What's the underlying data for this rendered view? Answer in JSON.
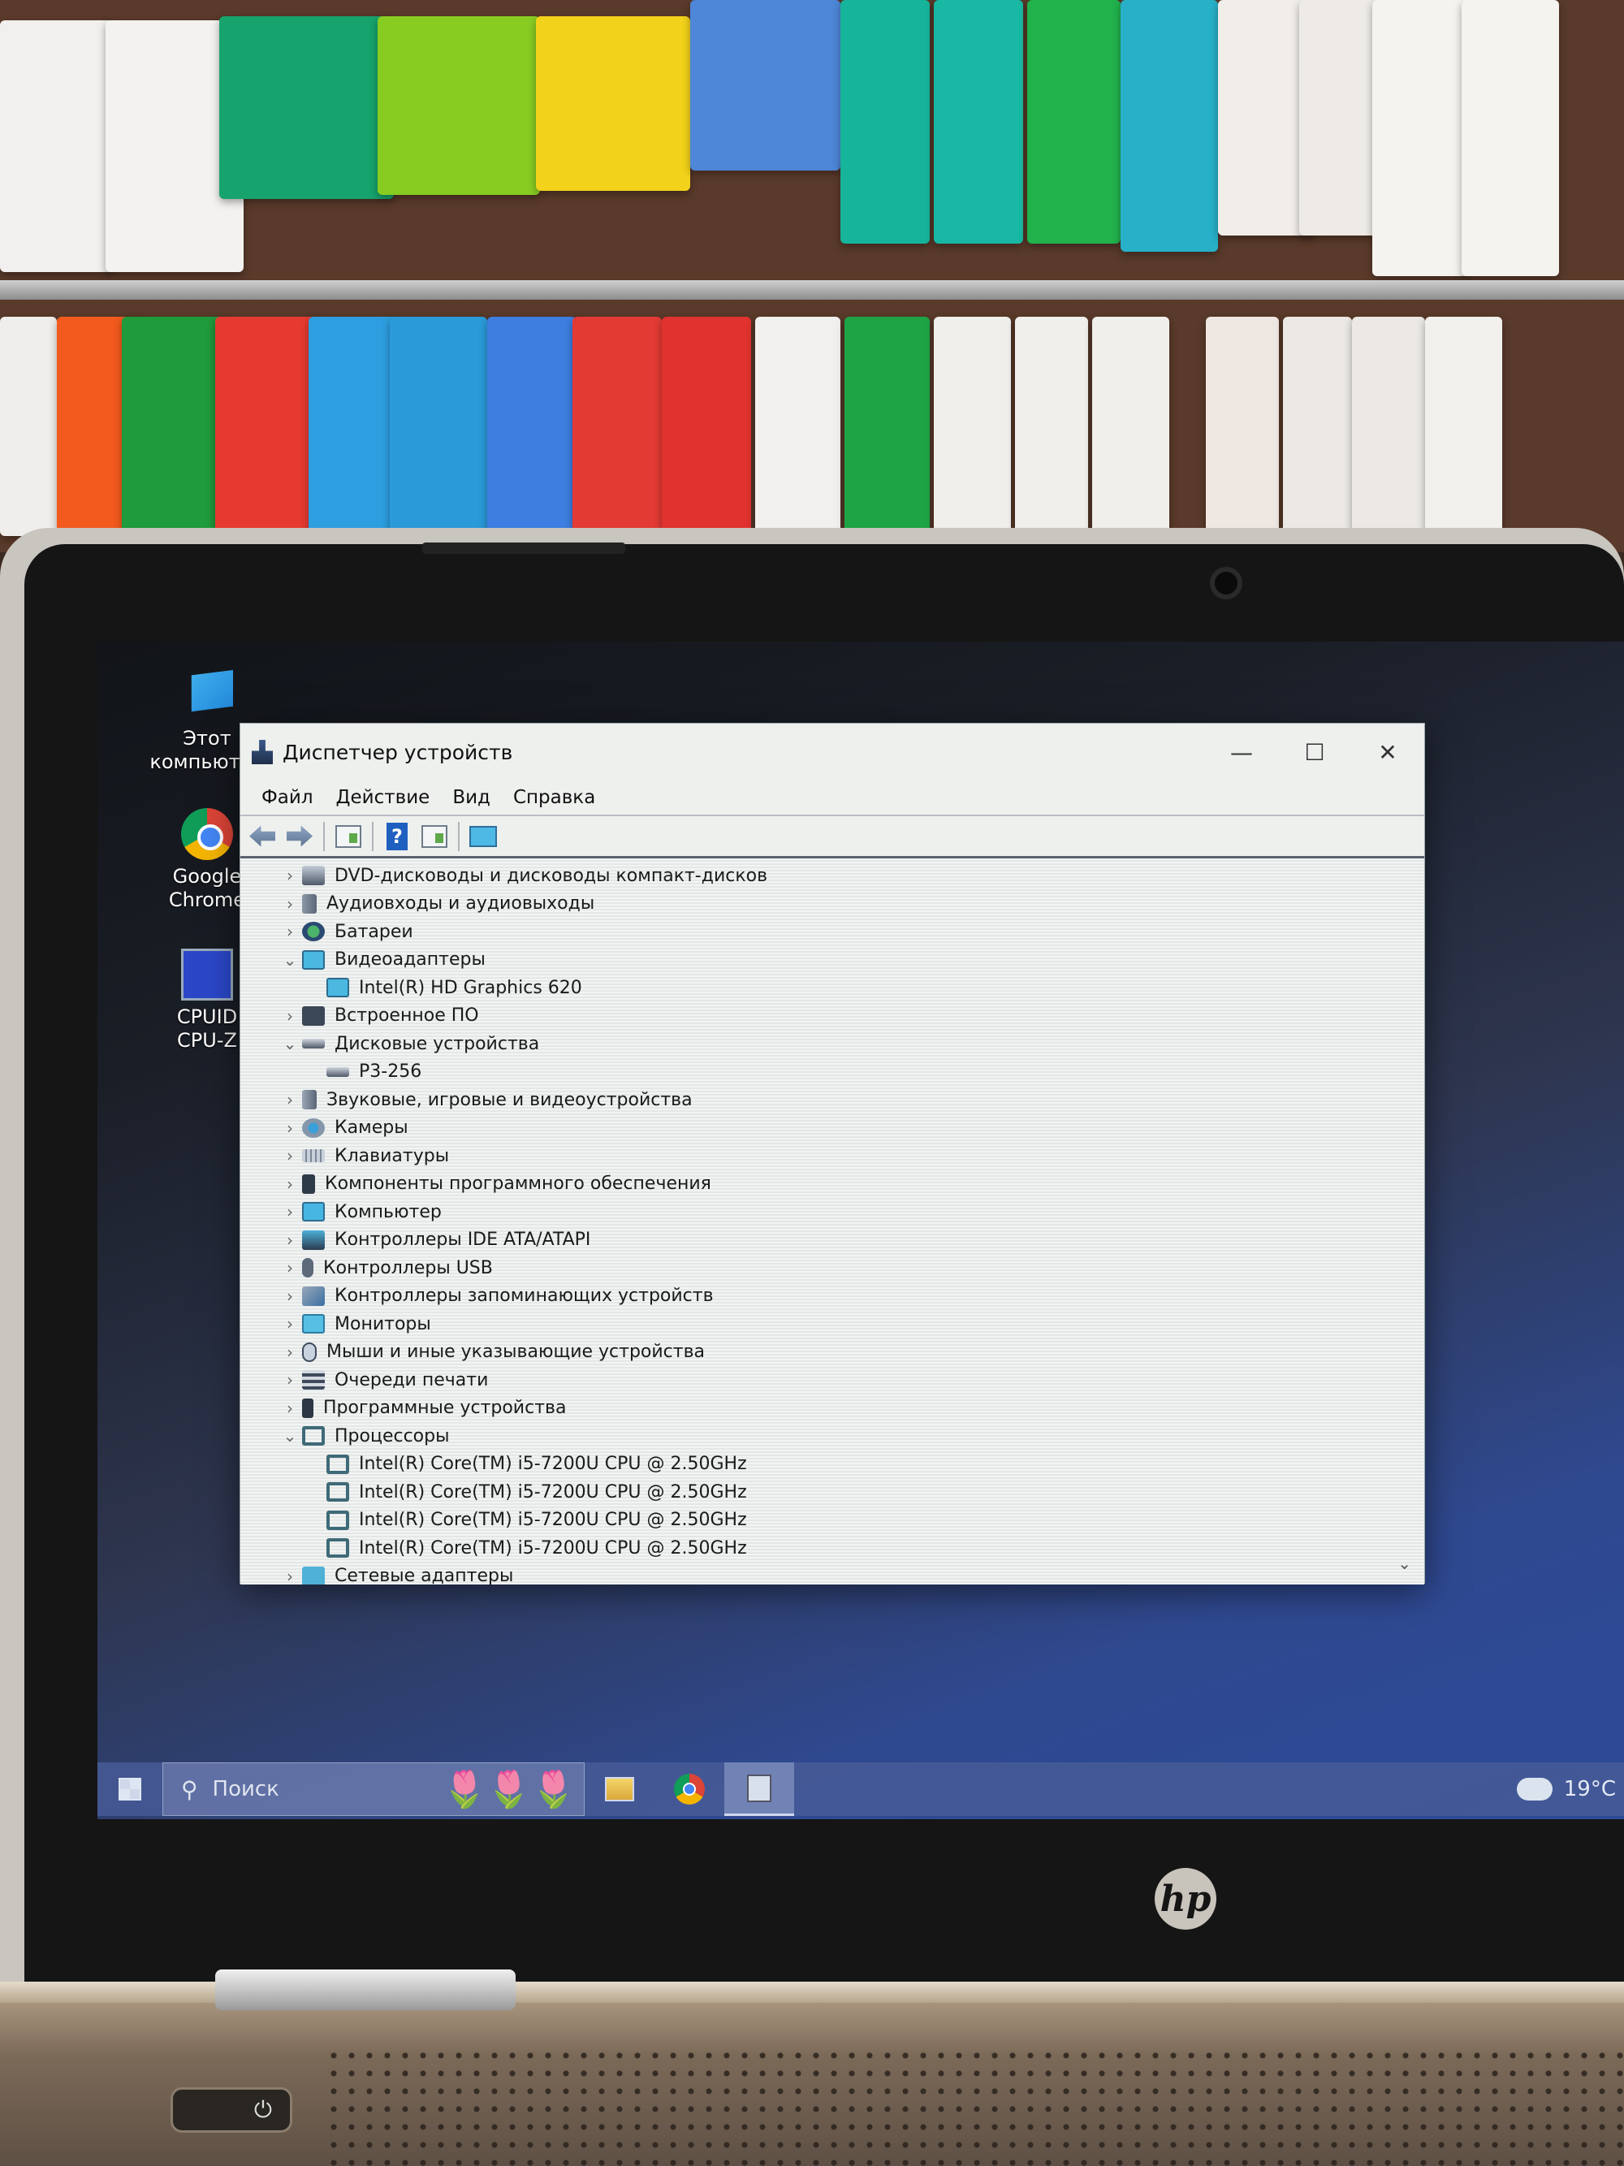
{
  "desktop": {
    "icons": [
      {
        "label_line1": "Этот",
        "label_line2": "компьютер",
        "icon": "this-pc-icon"
      },
      {
        "label_line1": "Google",
        "label_line2": "Chrome",
        "icon": "chrome-icon"
      },
      {
        "label_line1": "CPUID",
        "label_line2": "CPU-Z",
        "icon": "cpuz-icon"
      }
    ]
  },
  "window": {
    "title": "Диспетчер устройств",
    "controls": {
      "minimize": "—",
      "maximize": "☐",
      "close": "✕"
    },
    "menu": [
      "Файл",
      "Действие",
      "Вид",
      "Справка"
    ],
    "toolbar": [
      "back-icon",
      "forward-icon",
      "show-hide-console-tree-icon",
      "help-icon",
      "action-pane-icon",
      "scan-hardware-icon"
    ],
    "tree": [
      {
        "label": "DVD-дисководы и дисководы компакт-дисков",
        "level": 0,
        "expanded": false,
        "icon": "dvd"
      },
      {
        "label": "Аудиовходы и аудиовыходы",
        "level": 0,
        "expanded": false,
        "icon": "audio"
      },
      {
        "label": "Батареи",
        "level": 0,
        "expanded": false,
        "icon": "battery"
      },
      {
        "label": "Видеоадаптеры",
        "level": 0,
        "expanded": true,
        "icon": "display"
      },
      {
        "label": "Intel(R) HD Graphics 620",
        "level": 1,
        "icon": "display"
      },
      {
        "label": "Встроенное ПО",
        "level": 0,
        "expanded": false,
        "icon": "firmware"
      },
      {
        "label": "Дисковые устройства",
        "level": 0,
        "expanded": true,
        "icon": "disk"
      },
      {
        "label": "P3-256",
        "level": 1,
        "icon": "disk"
      },
      {
        "label": "Звуковые, игровые и видеоустройства",
        "level": 0,
        "expanded": false,
        "icon": "sound"
      },
      {
        "label": "Камеры",
        "level": 0,
        "expanded": false,
        "icon": "camera"
      },
      {
        "label": "Клавиатуры",
        "level": 0,
        "expanded": false,
        "icon": "keyboard"
      },
      {
        "label": "Компоненты программного обеспечения",
        "level": 0,
        "expanded": false,
        "icon": "swcomp"
      },
      {
        "label": "Компьютер",
        "level": 0,
        "expanded": false,
        "icon": "computer"
      },
      {
        "label": "Контроллеры IDE ATA/ATAPI",
        "level": 0,
        "expanded": false,
        "icon": "ide"
      },
      {
        "label": "Контроллеры USB",
        "level": 0,
        "expanded": false,
        "icon": "usb"
      },
      {
        "label": "Контроллеры запоминающих устройств",
        "level": 0,
        "expanded": false,
        "icon": "storage"
      },
      {
        "label": "Мониторы",
        "level": 0,
        "expanded": false,
        "icon": "monitor"
      },
      {
        "label": "Мыши и иные указывающие устройства",
        "level": 0,
        "expanded": false,
        "icon": "mouse"
      },
      {
        "label": "Очереди печати",
        "level": 0,
        "expanded": false,
        "icon": "printq"
      },
      {
        "label": "Программные устройства",
        "level": 0,
        "expanded": false,
        "icon": "swdev"
      },
      {
        "label": "Процессоры",
        "level": 0,
        "expanded": true,
        "icon": "cpu"
      },
      {
        "label": "Intel(R) Core(TM) i5-7200U CPU @ 2.50GHz",
        "level": 1,
        "icon": "cpu"
      },
      {
        "label": "Intel(R) Core(TM) i5-7200U CPU @ 2.50GHz",
        "level": 1,
        "icon": "cpu"
      },
      {
        "label": "Intel(R) Core(TM) i5-7200U CPU @ 2.50GHz",
        "level": 1,
        "icon": "cpu"
      },
      {
        "label": "Intel(R) Core(TM) i5-7200U CPU @ 2.50GHz",
        "level": 1,
        "icon": "cpu"
      },
      {
        "label": "Сетевые адаптеры",
        "level": 0,
        "expanded": false,
        "icon": "net"
      }
    ],
    "chevron_collapsed": "›",
    "chevron_expanded": "⌄",
    "scroll_down": "⌄"
  },
  "taskbar": {
    "search_placeholder": "Поиск",
    "search_icon": "⚲",
    "search_decoration": "🌷🌷🌷",
    "weather_temp": "19°C"
  },
  "laptop": {
    "brand_logo": "hp",
    "power_symbol": "⏻"
  }
}
